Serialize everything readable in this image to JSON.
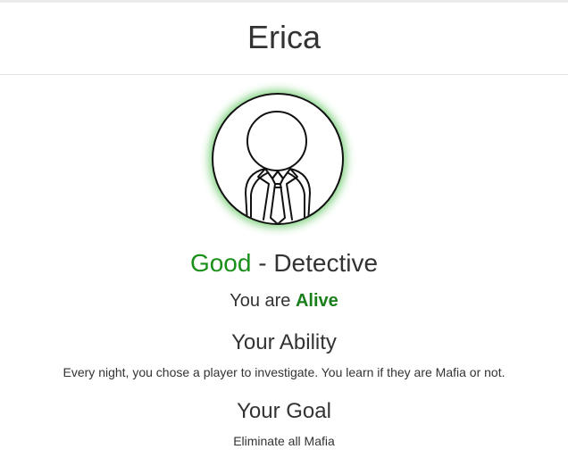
{
  "player": {
    "name": "Erica"
  },
  "avatar": {
    "icon": "detective-avatar-icon",
    "glow_color": "#7ed17e"
  },
  "role": {
    "alignment": "Good",
    "separator": " - ",
    "name": "Detective",
    "alignment_color": "#1a8f1a"
  },
  "status": {
    "prefix": "You are ",
    "value": "Alive",
    "value_color": "#1a7f1a"
  },
  "ability": {
    "heading": "Your Ability",
    "text": "Every night, you chose a player to investigate. You learn if they are Mafia or not."
  },
  "goal": {
    "heading": "Your Goal",
    "text": "Eliminate all Mafia"
  }
}
